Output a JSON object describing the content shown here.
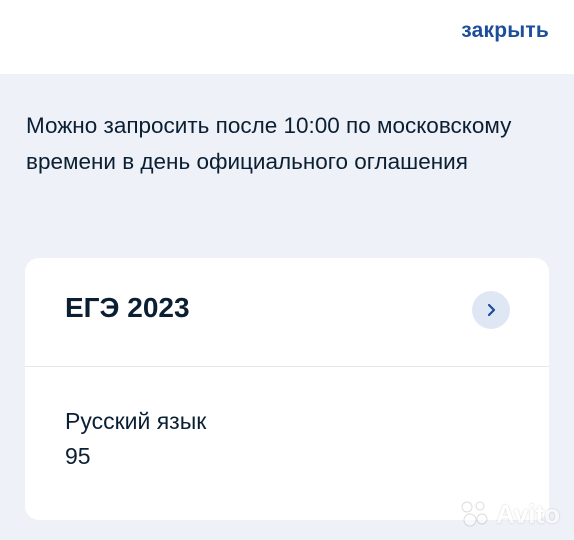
{
  "header": {
    "close_label": "закрыть"
  },
  "info": {
    "text": "Можно запросить после 10:00 по московскому времени в день официального оглашения"
  },
  "card": {
    "title": "ЕГЭ 2023",
    "subject": "Русский язык",
    "score": "95"
  },
  "watermark": {
    "text": "Avito"
  },
  "colors": {
    "accent": "#1c4e9a",
    "background": "#eef1f7",
    "card": "#ffffff",
    "text": "#0b1f33",
    "chevron_bg": "#dfe7f4"
  },
  "icons": {
    "chevron": "chevron-right-icon",
    "watermark_logo": "avito-logo-icon"
  }
}
